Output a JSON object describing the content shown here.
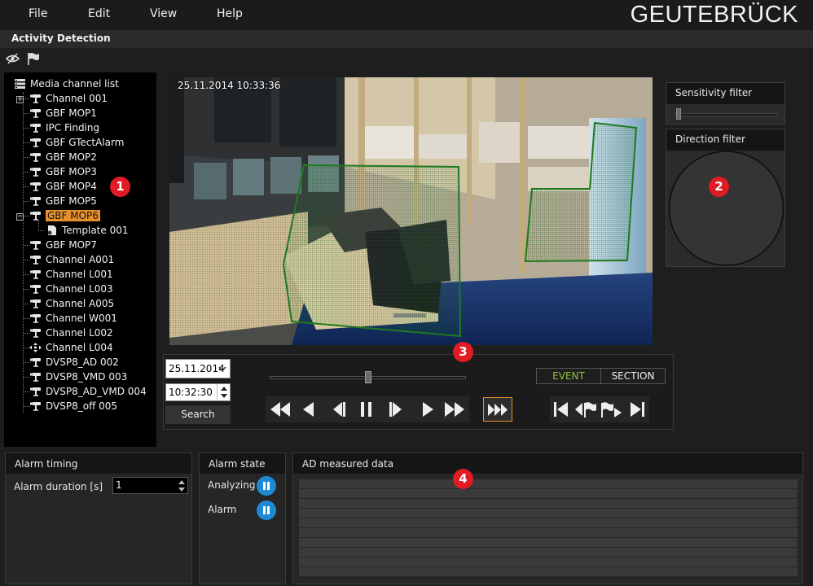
{
  "menu": {
    "items": [
      "File",
      "Edit",
      "View",
      "Help"
    ],
    "brand": "GEUTEBRÜCK"
  },
  "window": {
    "title": "Activity Detection"
  },
  "toolbar": {
    "icons": [
      "eye-off-icon",
      "flag-icon"
    ]
  },
  "tree": {
    "root": "Media channel list",
    "items": [
      {
        "label": "Channel 001"
      },
      {
        "label": "GBF MOP1"
      },
      {
        "label": "IPC Finding"
      },
      {
        "label": "GBF GTectAlarm"
      },
      {
        "label": "GBF MOP2"
      },
      {
        "label": "GBF MOP3"
      },
      {
        "label": "GBF MOP4"
      },
      {
        "label": "GBF MOP5"
      },
      {
        "label": "GBF MOP6"
      },
      {
        "label": "Template 001"
      },
      {
        "label": "GBF MOP7"
      },
      {
        "label": "Channel A001"
      },
      {
        "label": "Channel L001"
      },
      {
        "label": "Channel L003"
      },
      {
        "label": "Channel A005"
      },
      {
        "label": "Channel W001"
      },
      {
        "label": "Channel L002"
      },
      {
        "label": "Channel L004"
      },
      {
        "label": "DVSP8_AD 002"
      },
      {
        "label": "DVSP8_VMD 003"
      },
      {
        "label": "DVSP8_AD_VMD 004"
      },
      {
        "label": "DVSP8_off 005"
      }
    ],
    "selected": "GBF MOP6"
  },
  "video": {
    "timestamp": "25.11.2014 10:33:36"
  },
  "filters": {
    "sensitivity": "Sensitivity filter",
    "direction": "Direction filter"
  },
  "playback": {
    "date": "25.11.2014",
    "time": "10:32:30",
    "search_label": "Search",
    "event_label": "EVENT",
    "section_label": "SECTION",
    "position": 0.5,
    "accent": "#8cc63f"
  },
  "alarm_timing": {
    "title": "Alarm timing",
    "duration_label": "Alarm duration [s]",
    "duration_value": "1"
  },
  "alarm_state": {
    "title": "Alarm state",
    "analyzing_label": "Analyzing",
    "alarm_label": "Alarm"
  },
  "measured": {
    "title": "AD measured data"
  },
  "markers": [
    "1",
    "2",
    "3",
    "4"
  ],
  "colors": {
    "selection": "#e8912b",
    "marker": "#e01b24",
    "state": "#1f8ad4",
    "zone": "#1e7a1e"
  }
}
